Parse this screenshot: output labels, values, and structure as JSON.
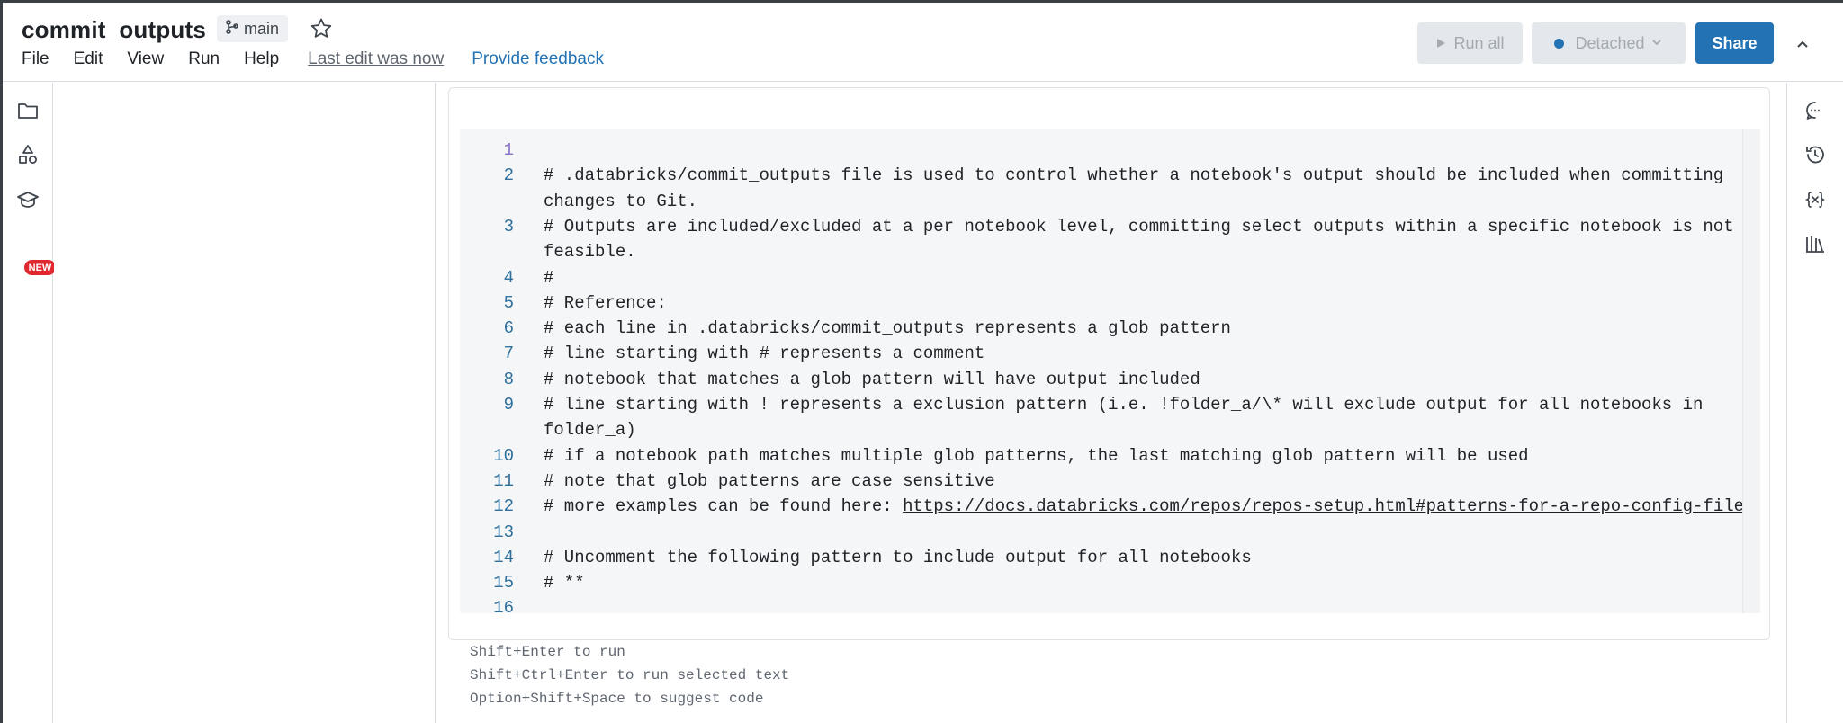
{
  "header": {
    "title": "commit_outputs",
    "branch": "main",
    "menu": [
      "File",
      "Edit",
      "View",
      "Run",
      "Help"
    ],
    "last_edit": "Last edit was now",
    "feedback": "Provide feedback",
    "run_all": "Run all",
    "compute": "Detached",
    "share": "Share"
  },
  "left_rail": {
    "icons": [
      "folder-icon",
      "shapes-icon",
      "graduation-cap-icon"
    ],
    "new_badge": "NEW"
  },
  "cell": {
    "lines": [
      {
        "n": "1",
        "text": ""
      },
      {
        "n": "2",
        "text": "# .databricks/commit_outputs file is used to control whether a notebook's output should be included when committing"
      },
      {
        "n": "",
        "text": "changes to Git."
      },
      {
        "n": "3",
        "text": "# Outputs are included/excluded at a per notebook level, committing select outputs within a specific notebook is not"
      },
      {
        "n": "",
        "text": "feasible."
      },
      {
        "n": "4",
        "text": "#"
      },
      {
        "n": "5",
        "text": "# Reference:"
      },
      {
        "n": "6",
        "text": "# each line in .databricks/commit_outputs represents a glob pattern"
      },
      {
        "n": "7",
        "text": "# line starting with # represents a comment"
      },
      {
        "n": "8",
        "text": "# notebook that matches a glob pattern will have output included"
      },
      {
        "n": "9",
        "text": "# line starting with ! represents a exclusion pattern (i.e. !folder_a/\\* will exclude output for all notebooks in"
      },
      {
        "n": "",
        "text": "folder_a)"
      },
      {
        "n": "10",
        "text": "# if a notebook path matches multiple glob patterns, the last matching glob pattern will be used"
      },
      {
        "n": "11",
        "text": "# note that glob patterns are case sensitive"
      },
      {
        "n": "12",
        "text": "# more examples can be found here: "
      },
      {
        "n": "13",
        "text": ""
      },
      {
        "n": "14",
        "text": "# Uncomment the following pattern to include output for all notebooks"
      },
      {
        "n": "15",
        "text": "# **"
      },
      {
        "n": "16",
        "text": ""
      }
    ],
    "link": "https://docs.databricks.com/repos/repos-setup.html#patterns-for-a-repo-config-file"
  },
  "hints": [
    "Shift+Enter to run",
    "Shift+Ctrl+Enter to run selected text",
    "Option+Shift+Space to suggest code"
  ],
  "right_rail": {
    "icons": [
      "comment-icon",
      "history-icon",
      "variables-icon",
      "library-icon"
    ]
  },
  "colors": {
    "accent": "#2272b4",
    "badge": "#e0282e"
  }
}
